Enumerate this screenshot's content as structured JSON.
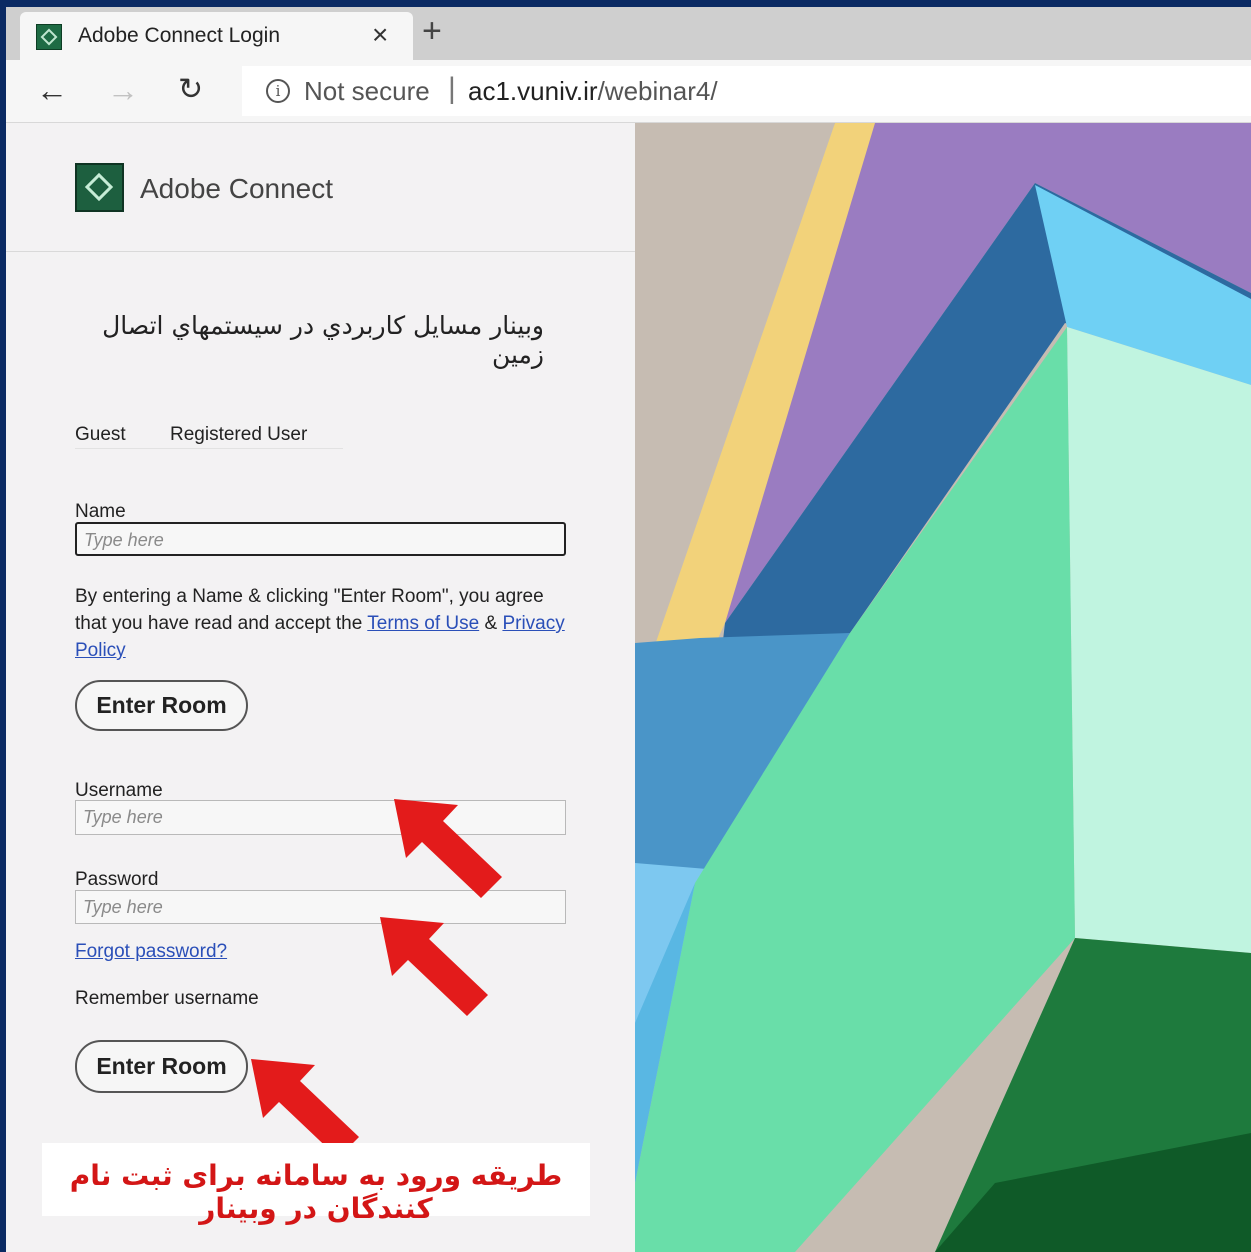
{
  "browser": {
    "tab_title": "Adobe Connect Login",
    "tab_close": "×",
    "new_tab": "+",
    "back": "←",
    "forward": "→",
    "reload": "↻",
    "security_label": "Not secure",
    "url_host": "ac1.vuniv.ir",
    "url_path": "/webinar4/"
  },
  "header": {
    "brand": "Adobe Connect"
  },
  "meeting": {
    "title": "وبينار مسايل كاربردي در سيستمهاي اتصال زمين"
  },
  "login_tabs": {
    "guest": "Guest",
    "registered": "Registered User"
  },
  "guest_form": {
    "name_label": "Name",
    "name_placeholder": "Type here",
    "consent_text": "By entering a Name & clicking \"Enter Room\", you agree that you have read and accept the",
    "terms_link": "Terms of Use",
    "and": "&",
    "privacy_link": "Privacy Policy",
    "enter_button": "Enter Room"
  },
  "registered_form": {
    "username_label": "Username",
    "username_placeholder": "Type here",
    "password_label": "Password",
    "password_placeholder": "Type here",
    "forgot_link": "Forgot password?",
    "remember_label": "Remember username",
    "enter_button": "Enter Room"
  },
  "annotation": {
    "caption": "طريقه ورود به سامانه براى ثبت نام كنندگان در وبينار",
    "arrow_color": "#e31b1b"
  },
  "colors": {
    "link": "#2a4fb8",
    "brand_green": "#1d5f3f"
  }
}
